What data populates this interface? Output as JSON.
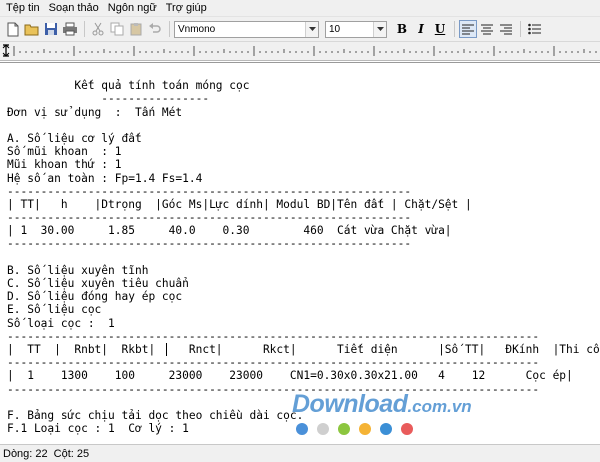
{
  "menu": [
    "Tệp tin",
    "Soạn thảo",
    "Ngôn ngữ",
    "Trợ giúp"
  ],
  "toolbar": {
    "font_name": "Vnmono",
    "font_size": "10",
    "bold_label": "B",
    "italic_label": "I",
    "underline_label": "U"
  },
  "editor": {
    "lines": [
      "",
      "          Kết quả tính toán móng cọc",
      "              ----------------",
      "Đơn vị sử dụng  :  Tấn Mét",
      "",
      "A. Số liệu cơ lý đất",
      "Số mũi khoan  : 1",
      "Mũi khoan thứ : 1",
      "Hệ số an toàn : Fp=1.4 Fs=1.4",
      "------------------------------------------------------------",
      "| TT|   h    |Dtrọng  |Góc Ms|Lực dính| Modul BD|Tên đất | Chặt/Sệt |",
      "------------------------------------------------------------",
      "| 1  30.00     1.85     40.0    0.30        460  Cát vừa Chặt vừa|",
      "------------------------------------------------------------",
      "",
      "B. Số liệu xuyên tĩnh",
      "C. Số liệu xuyên tiêu chuẩn",
      "D. Số liệu đóng hay ép cọc",
      "E. Số liệu cọc",
      "Số loại cọc :  1",
      "-------------------------------------------------------------------------------",
      "|  TT  |  Rnbt|  Rkbt|     Rnct|      Rkct|      Tiết diện      |Số TT|   ĐKính  |Thi công|",
      "-------------------------------------------------------------------------------",
      "|  1    1300    100     23000    23000    CN1=0.30x0.30x21.00   4    12      Cọc ép|",
      "-------------------------------------------------------------------------------",
      "",
      "F. Bảng sức chịu tải dọc theo chiều dài cọc.",
      "F.1 Loại cọc : 1  Cơ lý : 1",
      ""
    ]
  },
  "watermark": {
    "main": "Download",
    "tld": ".com.vn"
  },
  "dots": [
    "#4a90d9",
    "#cfcfcf",
    "#8cc63f",
    "#f5b335",
    "#3b8fd6",
    "#e95b5b"
  ],
  "status": {
    "line_label": "Dòng: 22",
    "col_label": "Cột: 25"
  }
}
